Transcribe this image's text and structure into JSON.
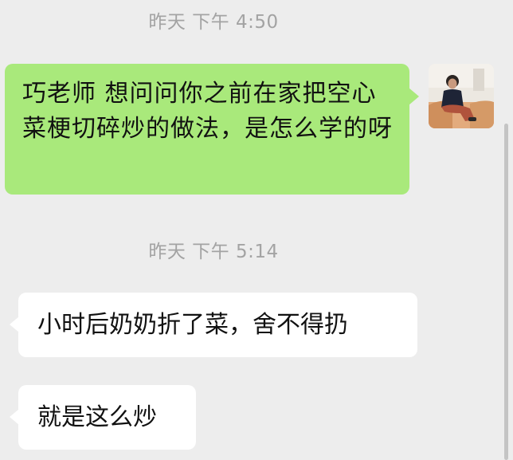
{
  "messages": [
    {
      "timestamp": "昨天 下午 4:50",
      "direction": "outgoing",
      "text": "巧老师 想问问你之前在家把空心菜梗切碎炒的做法，是怎么学的呀"
    },
    {
      "timestamp": "昨天 下午 5:14",
      "direction": "incoming",
      "text": "小时后奶奶折了菜，舍不得扔"
    },
    {
      "direction": "incoming",
      "text": "就是这么炒"
    }
  ],
  "colors": {
    "background": "#ededed",
    "outgoing_bubble": "#a9e97b",
    "incoming_bubble": "#ffffff",
    "timestamp_text": "#a3a3a3"
  }
}
